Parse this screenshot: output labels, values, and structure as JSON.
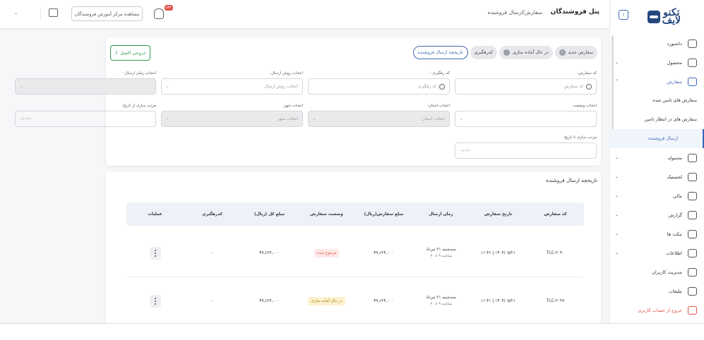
{
  "app": {
    "logo_line1": "تکنو",
    "logo_line2": "لایف",
    "panel_title": "پنل فروشندگان",
    "breadcrumb": "سفارش/ارسال فروشنده"
  },
  "header": {
    "help_center": "مشاهده مرکز آموزش فروشندگان",
    "notification_count": "۵۳۲"
  },
  "sidebar": {
    "items": [
      {
        "label": "داشبورد",
        "icon": "dashboard-icon",
        "has_chevron": false
      },
      {
        "label": "محصول",
        "icon": "product-icon",
        "has_chevron": true
      },
      {
        "label": "سفارش",
        "icon": "order-bag-icon",
        "has_chevron": true,
        "active": true
      }
    ],
    "sub_items": [
      {
        "label": "سفارش های تامین شده"
      },
      {
        "label": "سفارش های در انتظار تامین"
      },
      {
        "label": "ارسال فروشنده",
        "current": true
      }
    ],
    "items_after": [
      {
        "label": "محموله",
        "icon": "package-icon",
        "has_chevron": true
      },
      {
        "label": "لجستیک",
        "icon": "truck-icon",
        "has_chevron": true
      },
      {
        "label": "مالی",
        "icon": "wallet-icon",
        "has_chevron": true
      },
      {
        "label": "گزارش",
        "icon": "report-icon",
        "has_chevron": true
      },
      {
        "label": "تیکت ها",
        "icon": "ticket-icon",
        "has_chevron": true
      },
      {
        "label": "اطلاعات",
        "icon": "info-icon",
        "has_chevron": true
      },
      {
        "label": "مدیریت کاربران",
        "icon": "users-icon",
        "has_chevron": false
      },
      {
        "label": "تبلیغات",
        "icon": "megaphone-icon",
        "has_chevron": false
      }
    ],
    "logout": "خروج از حساب کاربری",
    "accent_color": "#3a67b5",
    "logout_color": "#e0504a"
  },
  "filters": {
    "tabs": [
      {
        "label": "سفارش جدید",
        "count": "۲"
      },
      {
        "label": "در حال آماده سازی",
        "count": "۰"
      },
      {
        "label": "کدرهگیری"
      },
      {
        "label": "تاریخچه ارسال فروشنده",
        "active": true
      }
    ],
    "excel_button": "خروجی اکسل",
    "order_code": {
      "label": "کد سفارش:",
      "placeholder": "کد سفارش"
    },
    "tracking_code": {
      "label": "کد رهگیری :",
      "placeholder": "کد رهگیری"
    },
    "send_method": {
      "label": "انتخاب روش ارسال:",
      "placeholder": "انتخاب روش ارسال"
    },
    "send_time": {
      "label": "انتخاب زمان ارسال:",
      "placeholder": ""
    },
    "status": {
      "label": "انتخاب وضعیت",
      "placeholder": ""
    },
    "province": {
      "label": "انتخاب استان:",
      "placeholder": "انتخاب استان"
    },
    "city": {
      "label": "انتخاب شهر:",
      "placeholder": "انتخاب شهر"
    },
    "from_date": {
      "label": "مرتب سازی از تاریخ:",
      "placeholder": "--/--/--"
    },
    "to_date": {
      "label": "مرتب سازی تا تاریخ:",
      "placeholder": "--/--/--"
    }
  },
  "table": {
    "title": "تاریخچه ارسال فروشنده",
    "headers": [
      "کد سفارش",
      "تاریخ سفارش",
      "زمان ارسال",
      "مبلغ سفارش(ریال)",
      "وضعیت سفارش",
      "مبلغ کل (ریال)",
      "کدرهگیری",
      "عملیات"
    ],
    "rows": [
      {
        "order_code": "TLC-۳۰۳۰",
        "order_date": "۱۴۰۴/۰۵/۲۱ | ۱۱:۴۶",
        "send_time_line1": "سه‌شنبه ۲۱ مرداد",
        "send_time_line2": "ساعت ۹ تا ۲۰",
        "order_amount": "۴۹,۶۲۴,۰۰۰",
        "status": "مرجوع شده",
        "status_bg": "#fde8e7",
        "status_color": "#e0504a",
        "total_amount": "۴۹,۶۲۴,۰۰۰",
        "tracking_code": "-"
      },
      {
        "order_code": "TLC-۳۰۳۷",
        "order_date": "۱۴۰۴/۰۵/۲۱ | ۱۱:۴۱",
        "send_time_line1": "سه‌شنبه ۲۱ مرداد",
        "send_time_line2": "ساعت ۹ تا ۲۰",
        "order_amount": "۴۹,۶۲۴,۰۰۰",
        "status": "در حال آماده سازی",
        "status_bg": "#fdf2cf",
        "status_color": "#a47c0a",
        "total_amount": "۴۹,۶۲۴,۰۰۰",
        "tracking_code": "-"
      }
    ]
  }
}
